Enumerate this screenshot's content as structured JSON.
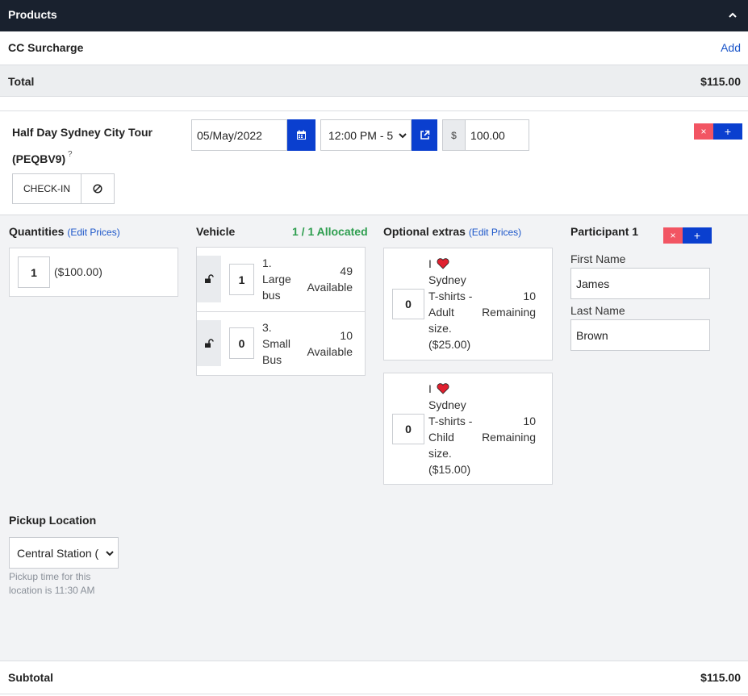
{
  "header": {
    "title": "Products"
  },
  "surcharge": {
    "label": "CC Surcharge",
    "add_label": "Add"
  },
  "total": {
    "label": "Total",
    "value": "$115.00"
  },
  "tour": {
    "name": "Half Day Sydney City Tour",
    "code": "(PEQBV9)",
    "help": "?",
    "checkin_label": "CHECK-IN",
    "date": "05/May/2022",
    "time": "12:00 PM - 5",
    "currency": "$",
    "price": "100.00",
    "remove_label": "×",
    "add_label": "+"
  },
  "quantities": {
    "label": "Quantities",
    "edit_prices": "(Edit Prices)",
    "qty": "1",
    "price": "($100.00)"
  },
  "vehicle": {
    "label": "Vehicle",
    "allocated": "1 / 1 Allocated",
    "items": [
      {
        "qty": "1",
        "name_lines": [
          "1.",
          "Large",
          "bus"
        ],
        "count": "49",
        "status": "Available"
      },
      {
        "qty": "0",
        "name_lines": [
          "3.",
          "Small",
          "Bus"
        ],
        "count": "10",
        "status": "Available"
      }
    ]
  },
  "extras": {
    "label": "Optional extras",
    "edit_prices": "(Edit Prices)",
    "items": [
      {
        "qty": "0",
        "prefix": "I",
        "lines": [
          "Sydney",
          "T-shirts -",
          "Adult",
          "size.",
          "($25.00)"
        ],
        "count": "10",
        "status": "Remaining"
      },
      {
        "qty": "0",
        "prefix": "I",
        "lines": [
          "Sydney",
          "T-shirts -",
          "Child",
          "size.",
          "($15.00)"
        ],
        "count": "10",
        "status": "Remaining"
      }
    ]
  },
  "participant": {
    "label": "Participant 1",
    "first_name_label": "First Name",
    "first_name": "James",
    "last_name_label": "Last Name",
    "last_name": "Brown"
  },
  "pickup": {
    "label": "Pickup Location",
    "selected": "Central Station (",
    "note_line1": "Pickup time for this",
    "note_line2": "location is 11:30 AM"
  },
  "subtotal": {
    "label": "Subtotal",
    "value": "$115.00"
  },
  "colors": {
    "header_bg": "#19212e",
    "primary": "#0a3fcf",
    "danger": "#f25563",
    "success": "#2e9e4f",
    "link": "#1a55c9"
  }
}
